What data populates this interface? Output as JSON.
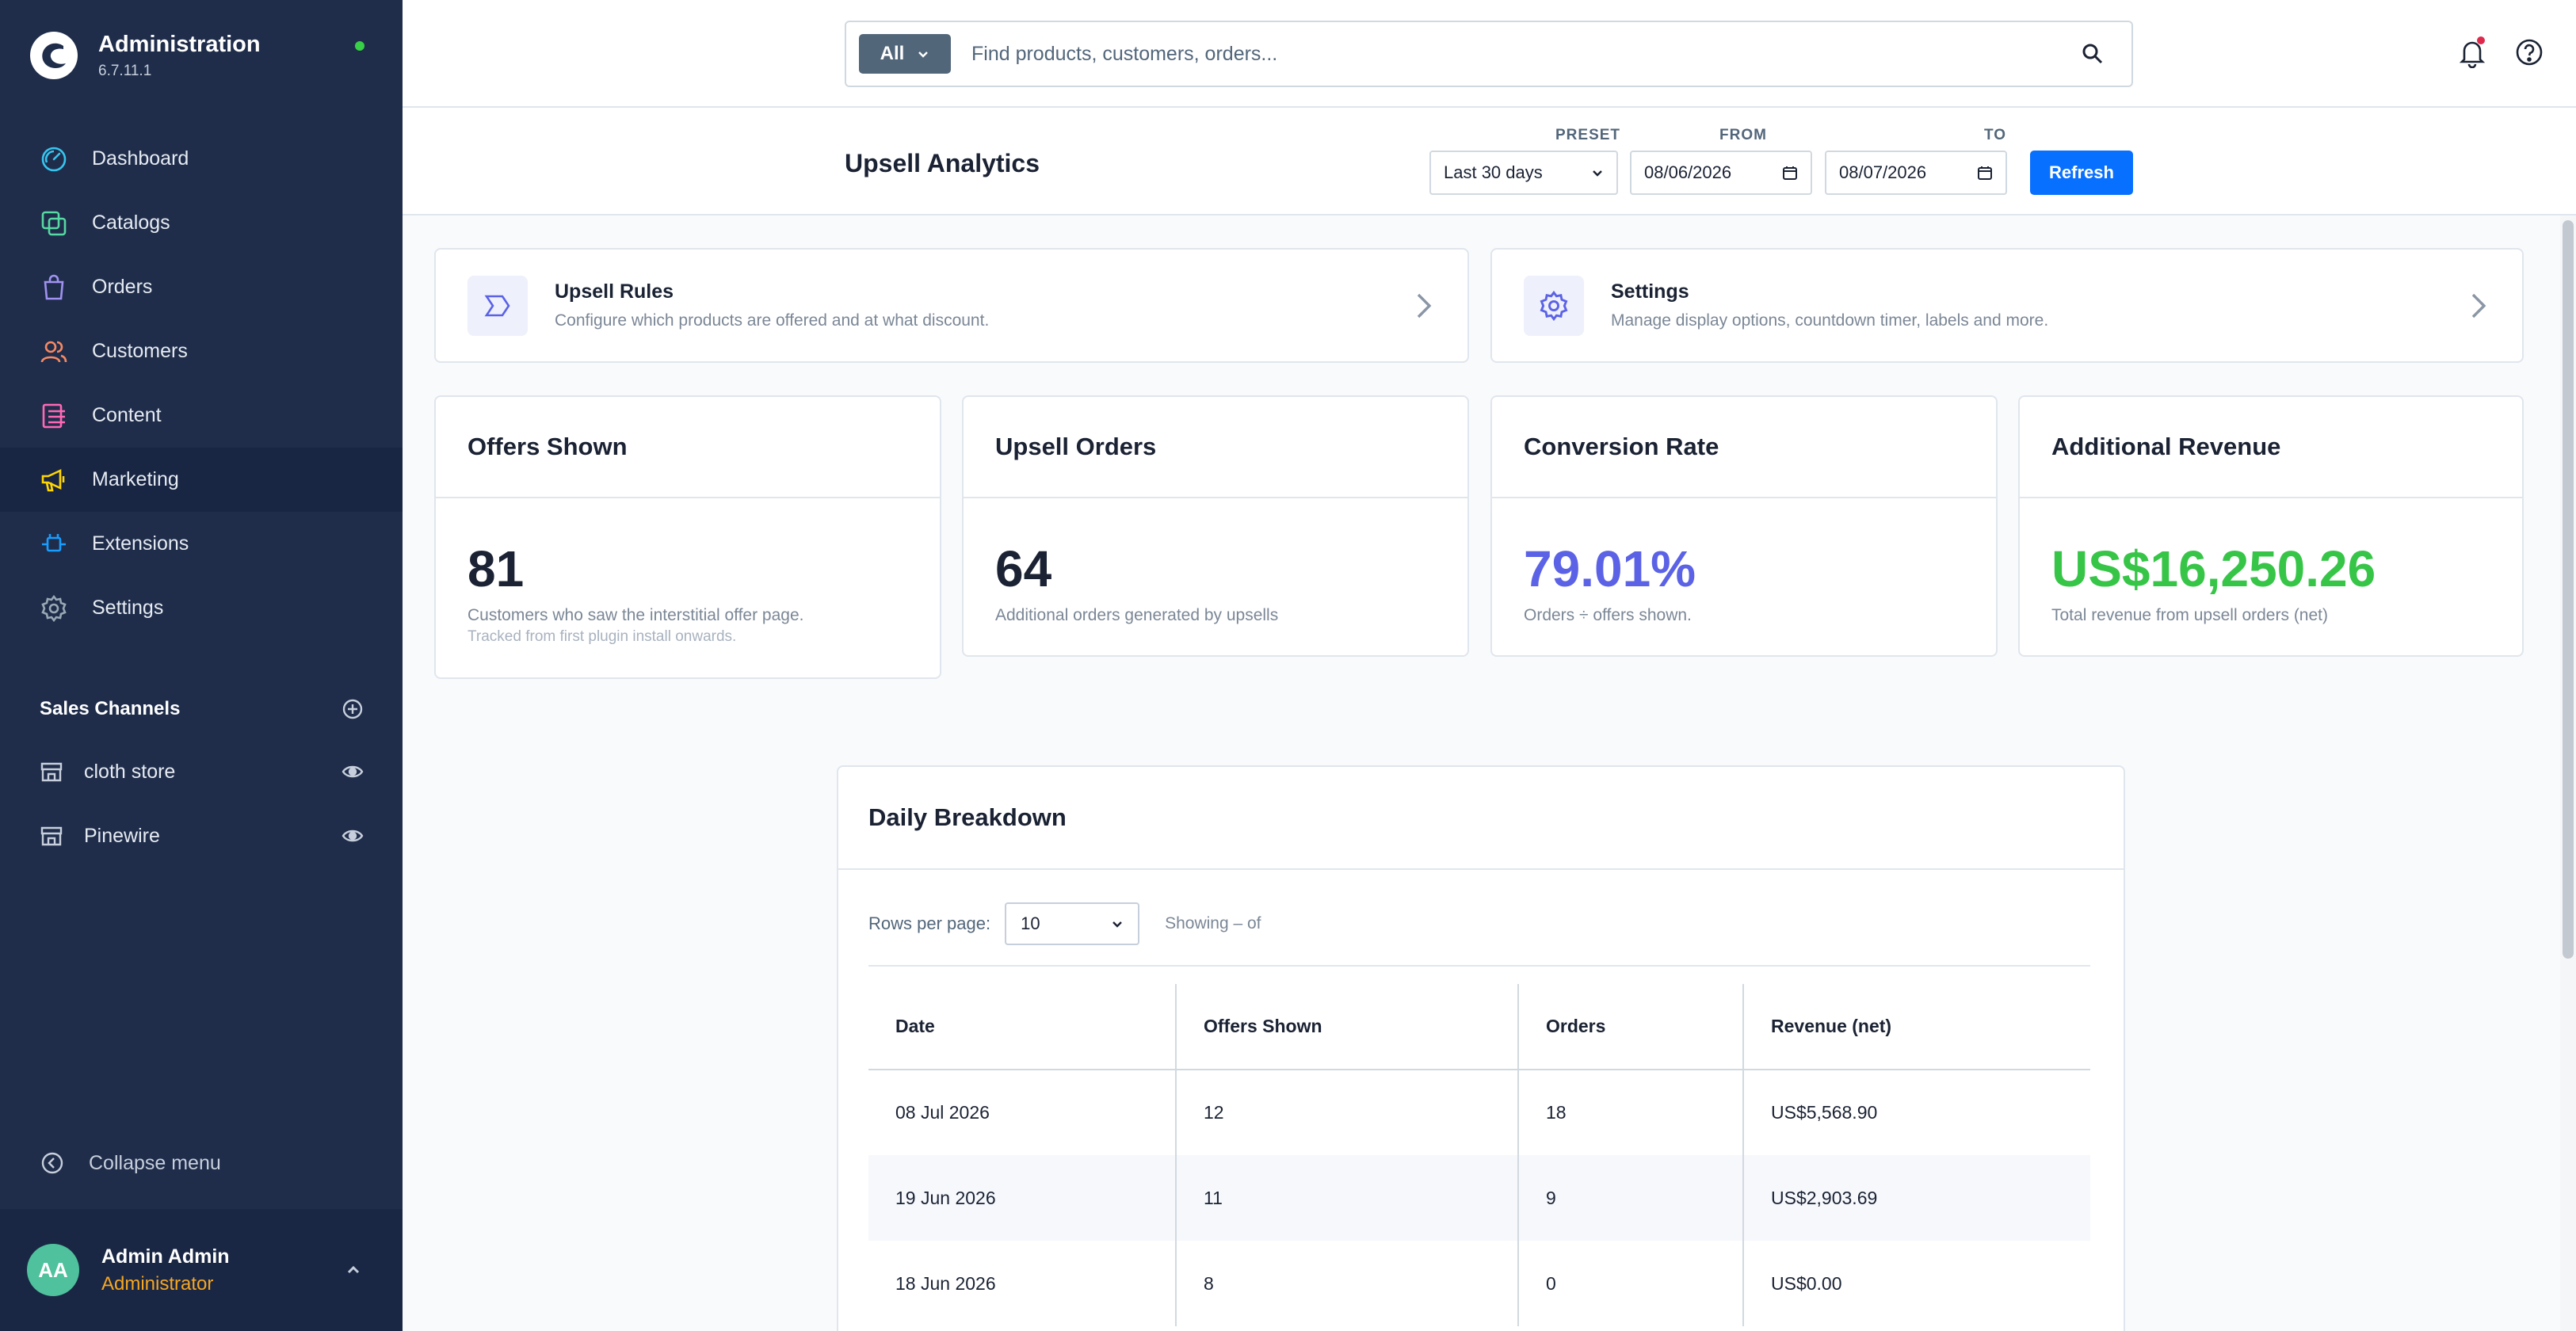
{
  "brand": {
    "title": "Administration",
    "version": "6.7.11.1"
  },
  "nav": [
    {
      "label": "Dashboard",
      "icon": "dashboard-icon",
      "color": "#37c5ee"
    },
    {
      "label": "Catalogs",
      "icon": "catalogs-icon",
      "color": "#57d9a3"
    },
    {
      "label": "Orders",
      "icon": "orders-icon",
      "color": "#a092f0"
    },
    {
      "label": "Customers",
      "icon": "customers-icon",
      "color": "#f88962"
    },
    {
      "label": "Content",
      "icon": "content-icon",
      "color": "#ff68b4"
    },
    {
      "label": "Marketing",
      "icon": "marketing-icon",
      "color": "#ffd700",
      "active": true
    },
    {
      "label": "Extensions",
      "icon": "extensions-icon",
      "color": "#189eff"
    },
    {
      "label": "Settings",
      "icon": "settings-icon",
      "color": "#9aa8b5"
    }
  ],
  "channels": {
    "title": "Sales Channels",
    "items": [
      {
        "label": "cloth store"
      },
      {
        "label": "Pinewire"
      }
    ]
  },
  "collapse_label": "Collapse menu",
  "user": {
    "initials": "AA",
    "name": "Admin Admin",
    "role": "Administrator"
  },
  "search": {
    "scope": "All",
    "placeholder": "Find products, customers, orders..."
  },
  "header": {
    "title": "Upsell Analytics",
    "preset_label": "PRESET",
    "preset_value": "Last 30 days",
    "from_label": "FROM",
    "from_value": "08/06/2026",
    "to_label": "TO",
    "to_value": "08/07/2026",
    "refresh_label": "Refresh"
  },
  "links": [
    {
      "title": "Upsell Rules",
      "desc": "Configure which products are offered and at what discount."
    },
    {
      "title": "Settings",
      "desc": "Manage display options, countdown timer, labels and more."
    }
  ],
  "stats": [
    {
      "title": "Offers Shown",
      "value": "81",
      "sub": "Customers who saw the interstitial offer page.",
      "sub2": "Tracked from first plugin install onwards.",
      "color": "#1a2233"
    },
    {
      "title": "Upsell Orders",
      "value": "64",
      "sub": "Additional orders generated by upsells",
      "color": "#1a2233"
    },
    {
      "title": "Conversion Rate",
      "value": "79.01%",
      "sub": "Orders ÷ offers shown.",
      "color": "#5b62e6"
    },
    {
      "title": "Additional Revenue",
      "value": "US$16,250.26",
      "sub": "Total revenue from upsell orders (net)",
      "color": "#37c548"
    }
  ],
  "daily": {
    "title": "Daily Breakdown",
    "rows_per_page_label": "Rows per page:",
    "rows_per_page_value": "10",
    "showing": "Showing – of",
    "columns": [
      "Date",
      "Offers Shown",
      "Orders",
      "Revenue (net)"
    ],
    "rows": [
      [
        "08 Jul 2026",
        "12",
        "18",
        "US$5,568.90"
      ],
      [
        "19 Jun 2026",
        "11",
        "9",
        "US$2,903.69"
      ],
      [
        "18 Jun 2026",
        "8",
        "0",
        "US$0.00"
      ]
    ]
  }
}
